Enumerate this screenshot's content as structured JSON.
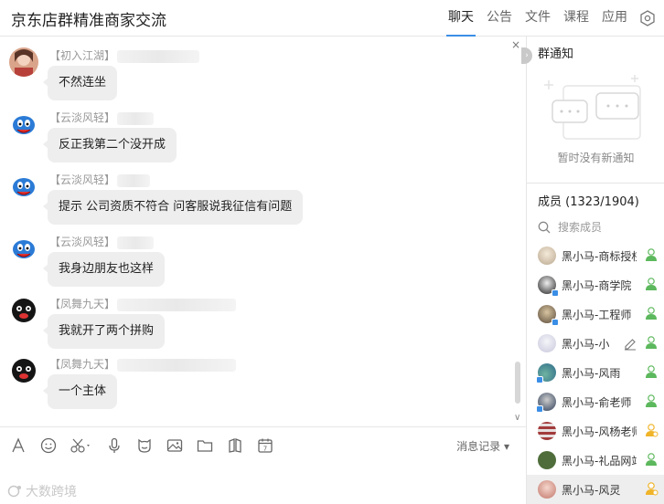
{
  "header": {
    "title": "京东店群精准商家交流",
    "tabs": [
      {
        "label": "聊天",
        "active": true
      },
      {
        "label": "公告",
        "active": false
      },
      {
        "label": "文件",
        "active": false
      },
      {
        "label": "课程",
        "active": false
      },
      {
        "label": "应用",
        "active": false
      }
    ],
    "settings_icon": "gear-icon"
  },
  "chat": {
    "close_glyph": "×",
    "messages": [
      {
        "sender": "【初入江湖】",
        "text": "不然连坐",
        "avatar": "photo-avatar"
      },
      {
        "sender": "【云淡风轻】",
        "text": "反正我第二个没开成",
        "avatar": "cartoon-avatar"
      },
      {
        "sender": "【云淡风轻】",
        "text": "提示 公司资质不符合 问客服说我征信有问题",
        "avatar": "cartoon-avatar"
      },
      {
        "sender": "【云淡风轻】",
        "text": "我身边朋友也这样",
        "avatar": "cartoon-avatar"
      },
      {
        "sender": "【凤舞九天】",
        "text": "我就开了两个拼购",
        "avatar": "black-cartoon-avatar"
      },
      {
        "sender": "【凤舞九天】",
        "text": "一个主体",
        "avatar": "black-cartoon-avatar"
      }
    ]
  },
  "toolbar": {
    "history_label": "消息记录",
    "history_arrow": "▾",
    "tools": [
      "font-icon",
      "emoji-icon",
      "screenshot-icon",
      "mic-icon",
      "sticker-icon",
      "image-icon",
      "folder-icon",
      "app-icon",
      "calendar-icon"
    ]
  },
  "watermark": "大数跨境",
  "notice": {
    "title": "群通知",
    "empty": "暂时没有新通知",
    "collapse_glyph": "›"
  },
  "members": {
    "title": "成员 (1323/1904)",
    "search_placeholder": "搜索成员",
    "list": [
      {
        "name": "黑小马-商标授权",
        "role": "admin"
      },
      {
        "name": "黑小马-商学院",
        "role": "admin"
      },
      {
        "name": "黑小马-工程师",
        "role": "admin"
      },
      {
        "name": "黑小马-小",
        "role": "admin",
        "editable": true
      },
      {
        "name": "黑小马-风雨",
        "role": "admin"
      },
      {
        "name": "黑小马-俞老师",
        "role": "admin"
      },
      {
        "name": "黑小马-风杨老师",
        "role": "owner"
      },
      {
        "name": "黑小马-礼品网站",
        "role": "admin"
      },
      {
        "name": "黑小马-风灵",
        "role": "owner",
        "selected": true
      }
    ]
  },
  "colors": {
    "accent": "#3a8ee6",
    "bubble": "#eeeeee",
    "admin_icon": "#5cb85c",
    "owner_icon": "#f0b429"
  }
}
